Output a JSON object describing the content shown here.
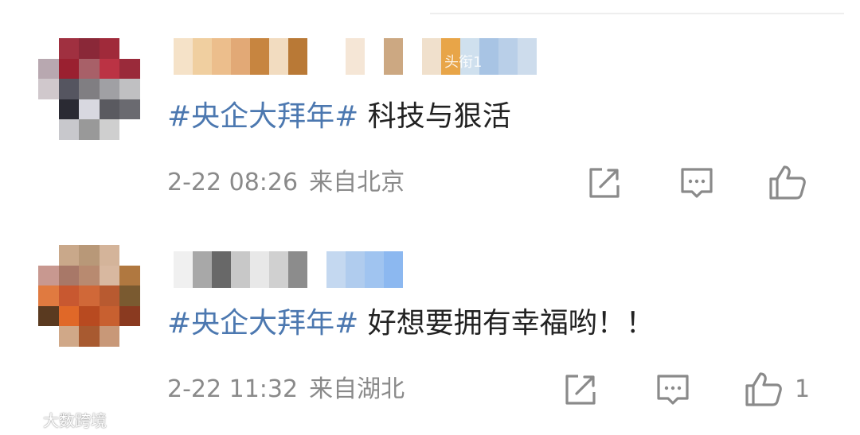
{
  "comments": [
    {
      "hashtag": "#央企大拜年#",
      "text": " 科技与狠活",
      "time": "2-22 08:26",
      "location": "来自北京",
      "like_count": "",
      "badge": "头衔1"
    },
    {
      "hashtag": "#央企大拜年#",
      "text": " 好想要拥有幸福哟！！",
      "time": "2-22 11:32",
      "location": "来自湖北",
      "like_count": "1"
    }
  ],
  "icons": [
    "share-icon",
    "comment-icon",
    "like-icon"
  ],
  "watermark": {
    "text": "大数跨境"
  },
  "colors": {
    "hashtag": "#4c78b0",
    "text": "#222222",
    "meta": "#8a8a8a"
  }
}
